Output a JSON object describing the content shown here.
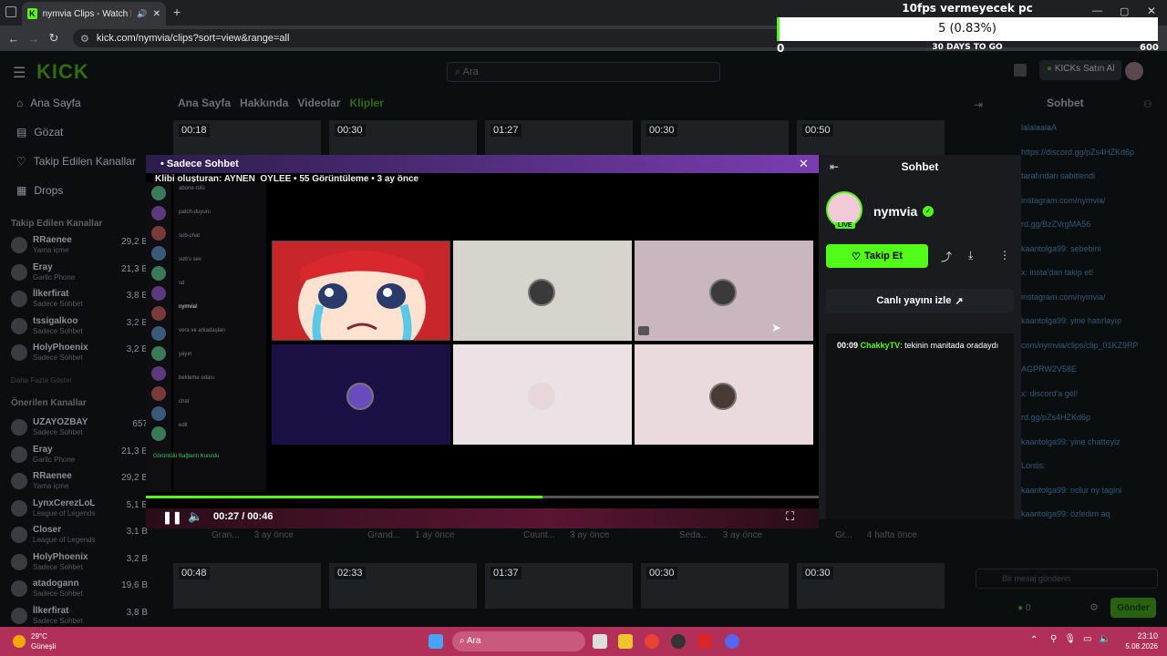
{
  "browser": {
    "tab_title": "nymvia Clips - Watch Live c",
    "url": "kick.com/nymvia/clips?sort=view&range=all"
  },
  "overlay": {
    "title": "10fps vermeyecek pc",
    "progress_text": "5 (0.83%)",
    "progress_fraction": 0.0083,
    "min": "0",
    "max": "600",
    "days_left": "30 DAYS TO GO"
  },
  "header": {
    "logo": "KICK",
    "search_placeholder": "Ara",
    "kicks_button": "KICKs Satın Al"
  },
  "sidebar": {
    "nav": [
      {
        "label": "Ana Sayfa",
        "icon": "home-icon"
      },
      {
        "label": "Gözat",
        "icon": "browse-icon"
      },
      {
        "label": "Takip Edilen Kanallar",
        "icon": "heart-icon"
      },
      {
        "label": "Drops",
        "icon": "drops-icon"
      }
    ],
    "followed_title": "Takip Edilen Kanallar",
    "followed": [
      {
        "name": "RRaenee",
        "game": "Yama içme",
        "viewers": "29,2 B"
      },
      {
        "name": "Eray",
        "game": "Garlic Phone",
        "viewers": "21,3 B"
      },
      {
        "name": "İlkerfirat",
        "game": "Sadece Sohbet",
        "viewers": "3,8 B"
      },
      {
        "name": "tssigalkoo",
        "game": "Sadece Sohbet",
        "viewers": "3,2 B"
      },
      {
        "name": "HolyPhoenix",
        "game": "Sadece Sohbet",
        "viewers": "3,2 B"
      }
    ],
    "more": "Daha Fazla Göster",
    "recommended_title": "Önerilen Kanallar",
    "recommended": [
      {
        "name": "UZAYOZBAY",
        "game": "Sadece Sohbet",
        "viewers": "657"
      },
      {
        "name": "Eray",
        "game": "Garlic Phone",
        "viewers": "21,3 B"
      },
      {
        "name": "RRaenee",
        "game": "Yama içme",
        "viewers": "29,2 B"
      },
      {
        "name": "LynxCerezLoL",
        "game": "League of Legends",
        "viewers": "5,1 B"
      },
      {
        "name": "Closer",
        "game": "League of Legends",
        "viewers": "3,1 B"
      },
      {
        "name": "HolyPhoenix",
        "game": "Sadece Sohbet",
        "viewers": "3,2 B"
      },
      {
        "name": "atadogann",
        "game": "Sadece Sohbet",
        "viewers": "19,6 B"
      },
      {
        "name": "İlkerfirat",
        "game": "Sadece Sohbet",
        "viewers": "3,8 B"
      }
    ]
  },
  "channel_tabs": [
    "Ana Sayfa",
    "Hakkında",
    "Videolar",
    "Klipler"
  ],
  "thumbs_top": [
    "00:18",
    "00:30",
    "01:27",
    "00:30",
    "00:50"
  ],
  "thumbs_bottom": [
    "00:48",
    "02:33",
    "01:37",
    "00:30",
    "00:30"
  ],
  "grid_meta": [
    {
      "title": "Gran...",
      "ago": "3 ay önce"
    },
    {
      "title": "Grand...",
      "ago": "1 ay önce"
    },
    {
      "title": "Count...",
      "ago": "3 ay önce"
    },
    {
      "title": "Seda...",
      "ago": "3 ay önce"
    },
    {
      "title": "Gr...",
      "ago": "4 hafta önce"
    }
  ],
  "modal": {
    "category": "Sadece Sohbet",
    "clip_info": "Klibi oluşturan: AYNEN_OYLEE • 55 Görüntüleme • 3 ay önce",
    "time": "00:27 / 00:46",
    "progress_fraction": 0.59,
    "discord_channels": [
      "abone-rolü",
      "patch-duyuru",
      "sub-chat",
      "sub's sev",
      "sd",
      "nymvia!",
      "vera ve arkadaşları",
      "yayın",
      "bekleme odası",
      "chat",
      "edit"
    ],
    "discord_status": "Görüntülü Bağlantı Kuruldu"
  },
  "chat_panel": {
    "title": "Sohbet",
    "streamer": "nymvia",
    "live_badge": "LIVE",
    "follow": "Takip Et",
    "watch_live": "Canlı yayını izle",
    "message": {
      "time": "00:09",
      "user": "ChakkyTV",
      "text": "tekinin manitada oradaydı"
    }
  },
  "bg_chat": {
    "title": "Sohbet",
    "lines": [
      "lalalaalaA",
      "https://discord.gg/pZs4HZKd6p",
      "tarafından sabitlendi",
      "instagram.com/nymvia/",
      "rd.gg/BzZVrgMA56",
      "kaantolga99: sebebini",
      "x: insta'dan takip et!",
      "instagram.com/nymvia/",
      "kaantolga99: yine hatırlayıp",
      "com/nymvia/clips/clip_01KZ9RP",
      "AGPRW2V58E",
      "x: discord'a gel!",
      "rd.gg/pZs4HZKd6p",
      "kaantolga99: yine chatteyiz",
      "Lontis:",
      "kaantolga99: nolur ny tagini",
      "kaantolga99: özledim aq"
    ],
    "input_placeholder": "Bir mesaj gönderin",
    "send": "Gönder",
    "points": "0"
  },
  "taskbar": {
    "weather_temp": "29°C",
    "weather_text": "Güneşli",
    "search": "Ara",
    "time": "23:10",
    "date": "5.08.2026"
  },
  "colors": {
    "kick_green": "#53fc18",
    "taskbar": "#b0305a"
  }
}
